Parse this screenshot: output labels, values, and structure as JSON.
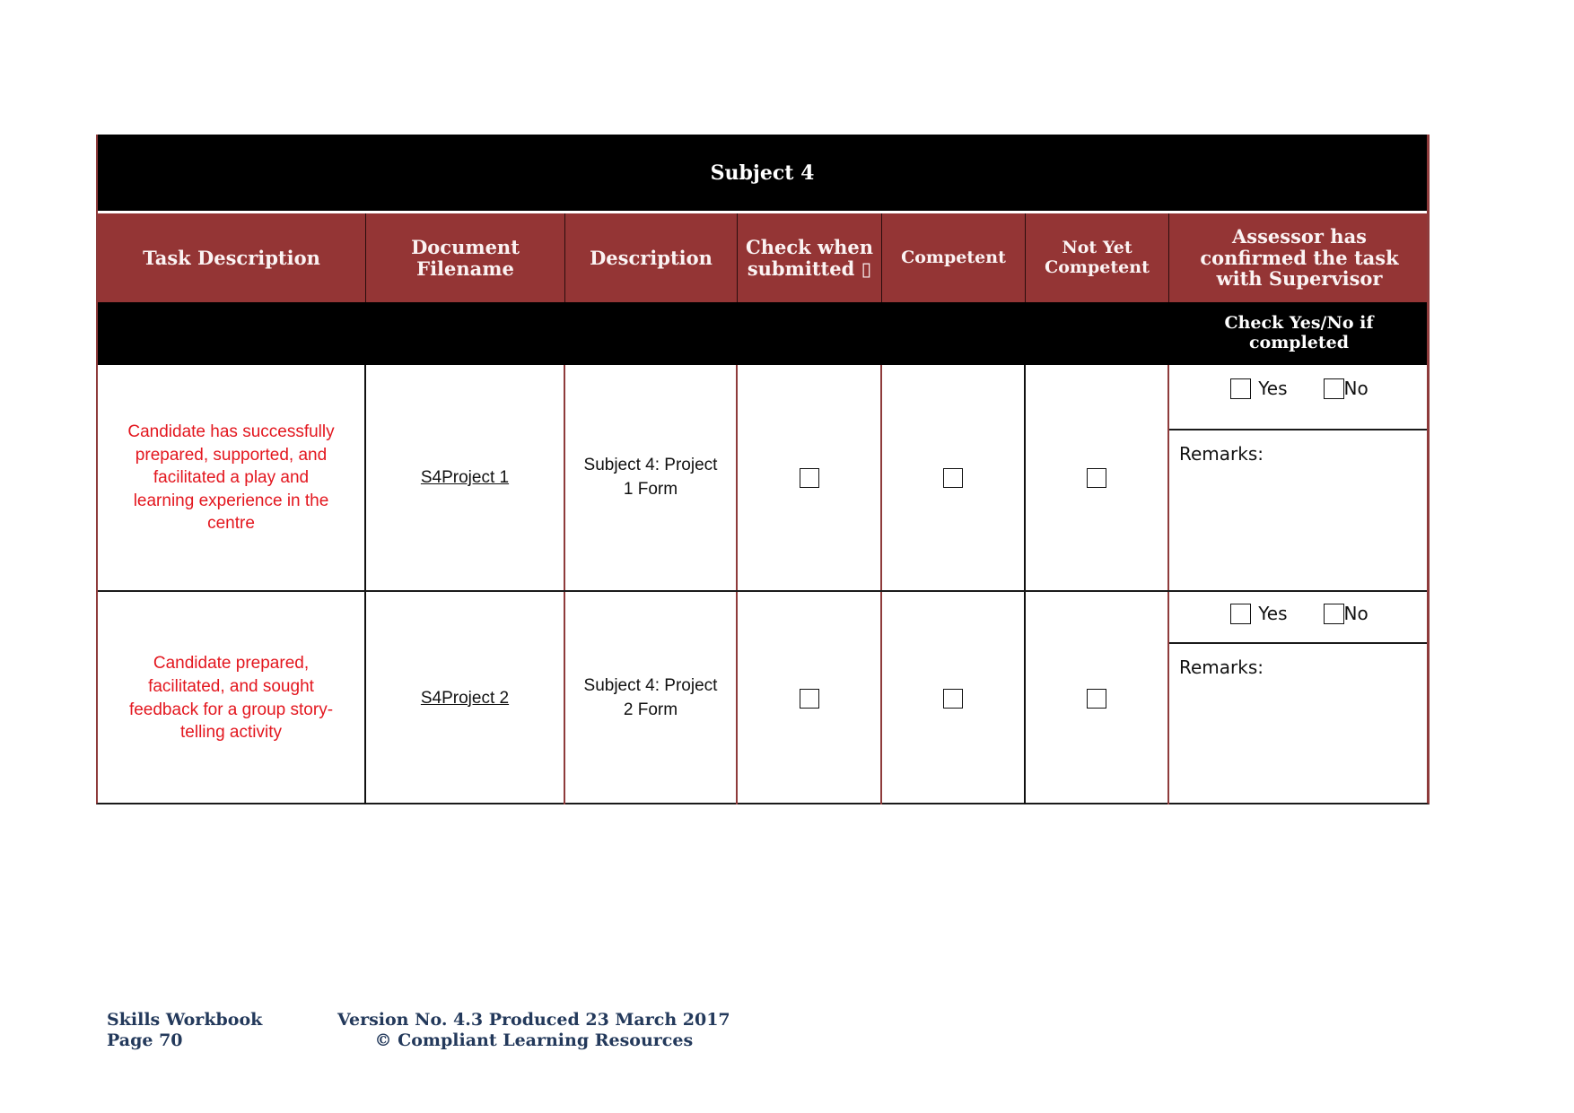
{
  "table": {
    "title": "Subject 4",
    "headers": {
      "task_description": "Task Description",
      "document_filename": "Document Filename",
      "description": "Description",
      "check_when_submitted": "Check when submitted ▯",
      "competent": "Competent",
      "not_yet_competent": "Not Yet Competent",
      "assessor_confirmed": "Assessor has confirmed the task with Supervisor"
    },
    "subheader": {
      "check_yes_no": "Check Yes/No if completed"
    },
    "rows": [
      {
        "task": "Candidate has successfully prepared, supported, and facilitated a play and learning experience in the centre",
        "filename": "S4Project 1",
        "description": "Subject 4: Project 1 Form",
        "submitted": false,
        "competent": false,
        "not_yet_competent": false,
        "yes_label": "Yes",
        "no_label": "No",
        "yes": false,
        "no": false,
        "remarks_label": "Remarks:"
      },
      {
        "task": "Candidate prepared, facilitated, and sought feedback for a group story-telling activity",
        "filename": "S4Project 2",
        "description": "Subject 4: Project 2 Form",
        "submitted": false,
        "competent": false,
        "not_yet_competent": false,
        "yes_label": "Yes",
        "no_label": "No",
        "yes": false,
        "no": false,
        "remarks_label": "Remarks:"
      }
    ]
  },
  "colors": {
    "header_maroon": "#943535",
    "title_black": "#000000",
    "task_text_red": "#e3171f",
    "footer_navy": "#23395b"
  },
  "footer": {
    "left_line1": "Skills Workbook",
    "left_line2": "Page 70",
    "right_line1": "Version No. 4.3 Produced 23 March 2017",
    "right_line2": "© Compliant Learning Resources"
  }
}
